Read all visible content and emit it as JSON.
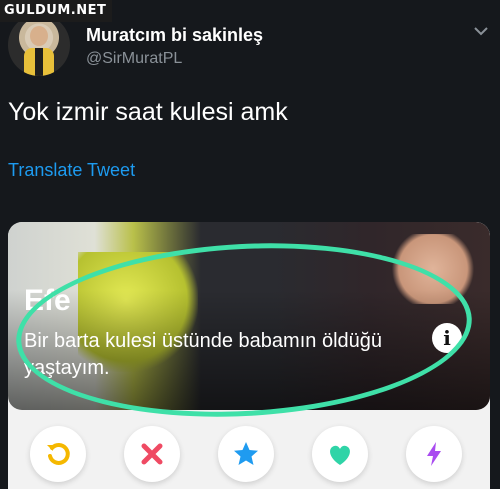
{
  "watermark": "GULDUM.NET",
  "tweet": {
    "display_name": "Muratcım bi sakinleş",
    "handle": "@SirMuratPL",
    "text": "Yok izmir saat kulesi amk",
    "translate_label": "Translate Tweet"
  },
  "card": {
    "profile_name": "Efe",
    "bio": "Bir barta kulesi üstünde babamın öldüğü yaştayım.",
    "info_icon": "i",
    "actions": [
      {
        "name": "rewind",
        "icon": "rewind-icon",
        "color": "#f5b800"
      },
      {
        "name": "nope",
        "icon": "x-icon",
        "color": "#ef4a63"
      },
      {
        "name": "super-like",
        "icon": "star-icon",
        "color": "#1f9bf0"
      },
      {
        "name": "like",
        "icon": "heart-icon",
        "color": "#2fd4a7"
      },
      {
        "name": "boost",
        "icon": "lightning-icon",
        "color": "#a94bf0"
      }
    ],
    "annotation_color": "#3fe0a8"
  }
}
